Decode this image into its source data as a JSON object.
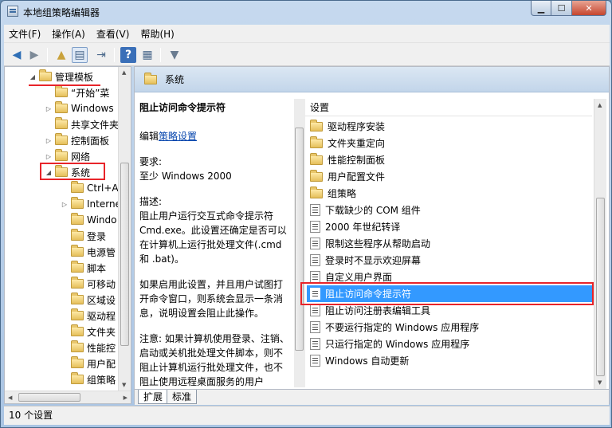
{
  "window": {
    "title": "本地组策略编辑器"
  },
  "menu": [
    "文件(F)",
    "操作(A)",
    "查看(V)",
    "帮助(H)"
  ],
  "toolbar": [
    "back-icon",
    "forward-icon",
    "up-folder-icon",
    "show-tree-icon",
    "export-icon",
    "help-icon",
    "properties-icon",
    "filter-icon"
  ],
  "tree": {
    "items": [
      {
        "label": "管理模板",
        "level": 0,
        "expander": "◢"
      },
      {
        "label": "“开始”菜",
        "level": 1,
        "expander": ""
      },
      {
        "label": "Windows",
        "level": 1,
        "expander": "▷"
      },
      {
        "label": "共享文件夹",
        "level": 1,
        "expander": ""
      },
      {
        "label": "控制面板",
        "level": 1,
        "expander": "▷"
      },
      {
        "label": "网络",
        "level": 1,
        "expander": "▷"
      },
      {
        "label": "系统",
        "level": 1,
        "expander": "◢"
      },
      {
        "label": "Ctrl+A",
        "level": 2,
        "expander": ""
      },
      {
        "label": "Interne",
        "level": 2,
        "expander": "▷"
      },
      {
        "label": "Windo",
        "level": 2,
        "expander": ""
      },
      {
        "label": "登录",
        "level": 2,
        "expander": ""
      },
      {
        "label": "电源管",
        "level": 2,
        "expander": ""
      },
      {
        "label": "脚本",
        "level": 2,
        "expander": ""
      },
      {
        "label": "可移动",
        "level": 2,
        "expander": ""
      },
      {
        "label": "区域设",
        "level": 2,
        "expander": ""
      },
      {
        "label": "驱动程",
        "level": 2,
        "expander": ""
      },
      {
        "label": "文件夹",
        "level": 2,
        "expander": ""
      },
      {
        "label": "性能控",
        "level": 2,
        "expander": ""
      },
      {
        "label": "用户配",
        "level": 2,
        "expander": ""
      },
      {
        "label": "组策略",
        "level": 2,
        "expander": ""
      }
    ]
  },
  "header": {
    "folder_name": "系统"
  },
  "description": {
    "title": "阻止访问命令提示符",
    "edit_prefix": "编辑",
    "edit_link": "策略设置",
    "requirement_label": "要求:",
    "requirement_value": "至少 Windows 2000",
    "desc_label": "描述:",
    "desc_text": "阻止用户运行交互式命令提示符 Cmd.exe。此设置还确定是否可以在计算机上运行批处理文件(.cmd 和 .bat)。",
    "desc_text2": "如果启用此设置，并且用户试图打开命令窗口，则系统会显示一条消息，说明设置会阻止此操作。",
    "desc_text3": "注意: 如果计算机使用登录、注销、启动或关机批处理文件脚本，则不阻止计算机运行批处理文件，也不阻止使用远程桌面服务的用户"
  },
  "settings": {
    "column_header": "设置",
    "rows": [
      {
        "label": "驱动程序安装",
        "type": "folder"
      },
      {
        "label": "文件夹重定向",
        "type": "folder"
      },
      {
        "label": "性能控制面板",
        "type": "folder"
      },
      {
        "label": "用户配置文件",
        "type": "folder"
      },
      {
        "label": "组策略",
        "type": "folder"
      },
      {
        "label": "下载缺少的 COM 组件",
        "type": "policy"
      },
      {
        "label": "2000 年世纪转译",
        "type": "policy"
      },
      {
        "label": "限制这些程序从帮助启动",
        "type": "policy"
      },
      {
        "label": "登录时不显示欢迎屏幕",
        "type": "policy"
      },
      {
        "label": "自定义用户界面",
        "type": "policy"
      },
      {
        "label": "阻止访问命令提示符",
        "type": "policy",
        "selected": true
      },
      {
        "label": "阻止访问注册表编辑工具",
        "type": "policy"
      },
      {
        "label": "不要运行指定的 Windows 应用程序",
        "type": "policy"
      },
      {
        "label": "只运行指定的 Windows 应用程序",
        "type": "policy"
      },
      {
        "label": "Windows 自动更新",
        "type": "policy"
      }
    ]
  },
  "tabs": [
    "扩展",
    "标准"
  ],
  "status": {
    "text": "10 个设置"
  },
  "colors": {
    "selection": "#3399ff",
    "highlight_box": "#e8242a",
    "link": "#0645ad"
  }
}
